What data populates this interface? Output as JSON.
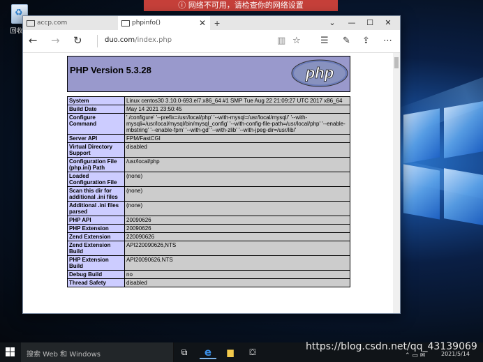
{
  "desktop": {
    "recycle_bin_label": "回收站",
    "notice": "ⓘ 网络不可用，请检查你的网络设置"
  },
  "browser": {
    "tabs": [
      {
        "label": "accp.com",
        "active": false
      },
      {
        "label": "phpinfo()",
        "active": true
      }
    ],
    "new_tab": "+",
    "address": {
      "host": "duo.com",
      "path": "/index.php"
    }
  },
  "php": {
    "version_title": "PHP Version 5.3.28",
    "logo_text": "php",
    "rows": [
      {
        "key": "System",
        "value": "Linux centos30 3.10.0-693.el7.x86_64 #1 SMP Tue Aug 22 21:09:27 UTC 2017 x86_64"
      },
      {
        "key": "Build Date",
        "value": "May 14 2021 23:50:45"
      },
      {
        "key": "Configure Command",
        "value": "'./configure' '--prefix=/usr/local/php' '--with-mysql=/usr/local/mysql/' '--with-mysqli=/usr/local/mysql/bin/mysql_config' '--with-config-file-path=/usr/local/php' '--enable-mbstring' '--enable-fpm' '--with-gd' '--with-zlib' '--with-jpeg-dir=/usr/lib/'"
      },
      {
        "key": "Server API",
        "value": "FPM/FastCGI"
      },
      {
        "key": "Virtual Directory Support",
        "value": "disabled"
      },
      {
        "key": "Configuration File (php.ini) Path",
        "value": "/usr/local/php"
      },
      {
        "key": "Loaded Configuration File",
        "value": "(none)"
      },
      {
        "key": "Scan this dir for additional .ini files",
        "value": "(none)"
      },
      {
        "key": "Additional .ini files parsed",
        "value": "(none)"
      },
      {
        "key": "PHP API",
        "value": "20090626"
      },
      {
        "key": "PHP Extension",
        "value": "20090626"
      },
      {
        "key": "Zend Extension",
        "value": "220090626"
      },
      {
        "key": "Zend Extension Build",
        "value": "API220090626,NTS"
      },
      {
        "key": "PHP Extension Build",
        "value": "API20090626,NTS"
      },
      {
        "key": "Debug Build",
        "value": "no"
      },
      {
        "key": "Thread Safety",
        "value": "disabled"
      }
    ]
  },
  "taskbar": {
    "search_placeholder": "搜索 Web 和 Windows",
    "watermark": "https://blog.csdn.net/qq_43139069",
    "time": "2021/5/14"
  },
  "colors": {
    "php_header_bg": "#9999cc",
    "php_key_bg": "#ccccff",
    "php_value_bg": "#cccccc"
  }
}
